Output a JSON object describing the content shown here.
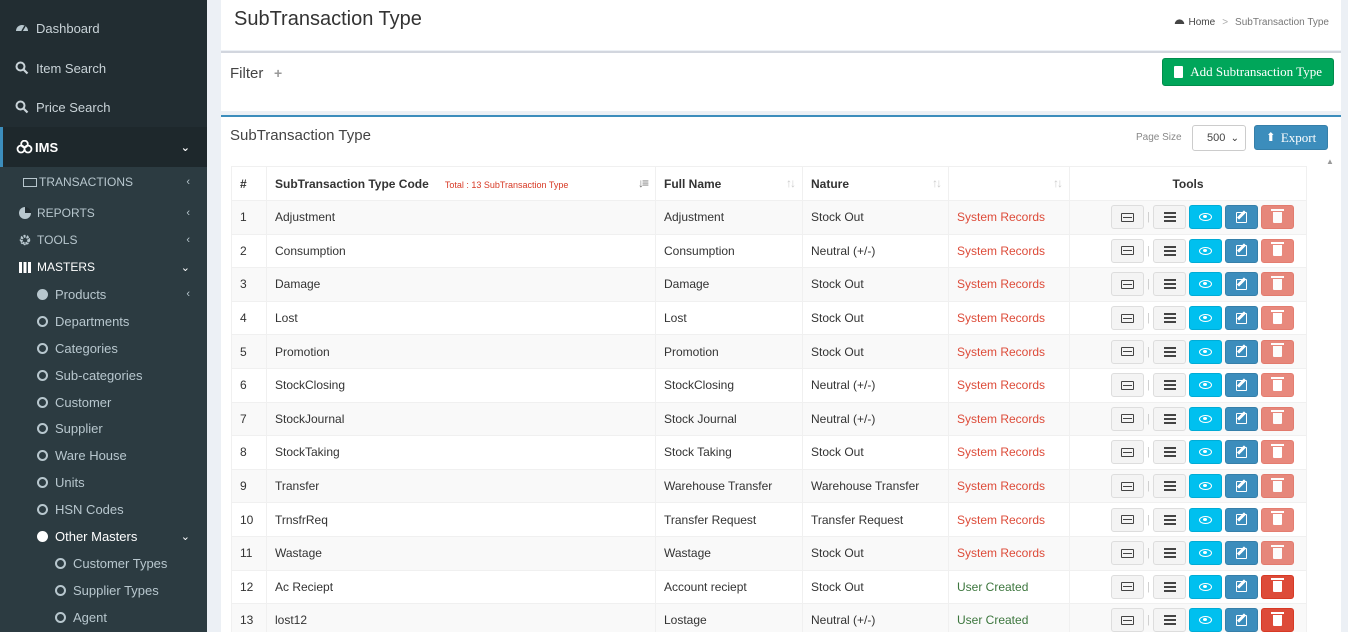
{
  "sidebar": {
    "top_items": [
      {
        "label": "Dashboard",
        "icon": "dashboard-icon"
      },
      {
        "label": "Item Search",
        "icon": "search-icon"
      },
      {
        "label": "Price Search",
        "icon": "search-icon"
      }
    ],
    "ims": {
      "label": "IMS",
      "icon": "cubes-icon"
    },
    "transactions": "TRANSACTIONS",
    "reports": "REPORTS",
    "tools": "TOOLS",
    "masters": "MASTERS",
    "products": "Products",
    "master_items": [
      "Departments",
      "Categories",
      "Sub-categories",
      "Customer",
      "Supplier",
      "Ware House",
      "Units",
      "HSN Codes"
    ],
    "other_masters": "Other Masters",
    "other_items": [
      "Customer Types",
      "Supplier Types",
      "Agent"
    ]
  },
  "header": {
    "title": "SubTransaction Type",
    "breadcrumb_home": "Home",
    "breadcrumb_sep": ">",
    "breadcrumb_current": "SubTransaction Type"
  },
  "filter": {
    "label": "Filter",
    "plus": "+",
    "add_button": "Add Subtransaction Type"
  },
  "table_box": {
    "title": "SubTransaction Type",
    "page_size_label": "Page Size",
    "page_size_value": "500",
    "export_label": "Export"
  },
  "table": {
    "headers": [
      "#",
      "SubTransaction Type Code",
      "Full Name",
      "Nature",
      "",
      "Tools"
    ],
    "total_text": "Total : 13 SubTransaction Type",
    "rows": [
      {
        "n": "1",
        "code": "Adjustment",
        "name": "Adjustment",
        "nature": "Stock Out",
        "type": "System Records"
      },
      {
        "n": "2",
        "code": "Consumption",
        "name": "Consumption",
        "nature": "Neutral (+/-)",
        "type": "System Records"
      },
      {
        "n": "3",
        "code": "Damage",
        "name": "Damage",
        "nature": "Stock Out",
        "type": "System Records"
      },
      {
        "n": "4",
        "code": "Lost",
        "name": "Lost",
        "nature": "Stock Out",
        "type": "System Records"
      },
      {
        "n": "5",
        "code": "Promotion",
        "name": "Promotion",
        "nature": "Stock Out",
        "type": "System Records"
      },
      {
        "n": "6",
        "code": "StockClosing",
        "name": "StockClosing",
        "nature": "Neutral (+/-)",
        "type": "System Records"
      },
      {
        "n": "7",
        "code": "StockJournal",
        "name": "Stock Journal",
        "nature": "Neutral (+/-)",
        "type": "System Records"
      },
      {
        "n": "8",
        "code": "StockTaking",
        "name": "Stock Taking",
        "nature": "Stock Out",
        "type": "System Records"
      },
      {
        "n": "9",
        "code": "Transfer",
        "name": "Warehouse Transfer",
        "nature": "Warehouse Transfer",
        "type": "System Records"
      },
      {
        "n": "10",
        "code": "TrnsfrReq",
        "name": "Transfer Request",
        "nature": "Transfer Request",
        "type": "System Records"
      },
      {
        "n": "11",
        "code": "Wastage",
        "name": "Wastage",
        "nature": "Stock Out",
        "type": "System Records"
      },
      {
        "n": "12",
        "code": "Ac Reciept",
        "name": "Account reciept",
        "nature": "Stock Out",
        "type": "User Created"
      },
      {
        "n": "13",
        "code": "lost12",
        "name": "Lostage",
        "nature": "Neutral (+/-)",
        "type": "User Created"
      }
    ]
  },
  "colors": {
    "sidebar_bg": "#222d32",
    "accent": "#3c8dbc",
    "success": "#00a65a",
    "danger": "#dd4b39",
    "info": "#00c0ef"
  }
}
